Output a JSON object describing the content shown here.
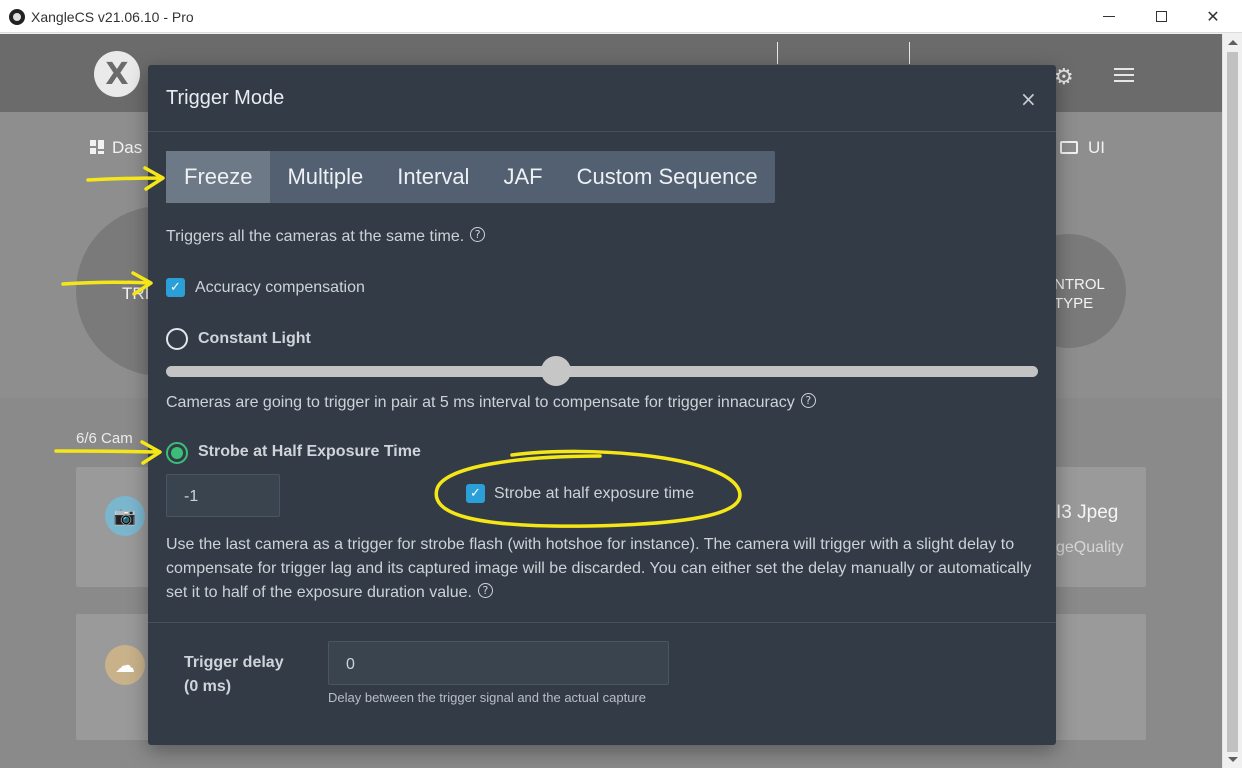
{
  "window": {
    "title": "XangleCS v21.06.10 - Pro",
    "minimize_glyph": "",
    "maximize_glyph": "",
    "close_glyph": "✕"
  },
  "background_app": {
    "logo_glyph": "X",
    "dashboard_label": "Das",
    "ui_label": "UI",
    "left_circle_text": "TRI",
    "right_circle_line1": "NTROL",
    "right_circle_line2": "TYPE",
    "camera_count": "6/6 Cam",
    "jpeg_label": "I3 Jpeg",
    "jpeg_sub": "geQuality",
    "icons": [
      "gear-icon",
      "menu-icon",
      "dashboard-icon",
      "monitor-icon",
      "camera-icon",
      "cloud-icon"
    ]
  },
  "modal": {
    "title": "Trigger Mode",
    "close_glyph": "×",
    "tabs": [
      {
        "label": "Freeze",
        "active": true
      },
      {
        "label": "Multiple",
        "active": false
      },
      {
        "label": "Interval",
        "active": false
      },
      {
        "label": "JAF",
        "active": false
      },
      {
        "label": "Custom Sequence",
        "active": false
      }
    ],
    "description": "Triggers all the cameras at the same time.",
    "help_glyph": "?",
    "accuracy": {
      "label": "Accuracy compensation",
      "checked": true
    },
    "constant_light": {
      "label": "Constant Light",
      "selected": false
    },
    "slider": {
      "value_fraction": 0.44
    },
    "slider_description": "Cameras are going to trigger in pair at 5 ms interval to compensate for trigger innacuracy",
    "strobe": {
      "label": "Strobe at Half Exposure Time",
      "selected": true,
      "input_value": "-1",
      "checkbox_label": "Strobe at half exposure time",
      "checkbox_checked": true,
      "description": "Use the last camera as a trigger for strobe flash (with hotshoe for instance). The camera will trigger with a slight delay to compensate for trigger lag and its captured image will be discarded. You can either set the delay manually or automatically set it to half of the exposure duration value."
    },
    "trigger_delay": {
      "label_line1": "Trigger delay",
      "label_line2": "(0 ms)",
      "value": "0",
      "help": "Delay between the trigger signal and the actual capture"
    },
    "checkmark_glyph": "✓"
  },
  "colors": {
    "modal_bg": "#333c46",
    "accent_blue": "#2b9fd8",
    "radio_green": "#3bbf78",
    "annotation_yellow": "#f5e617"
  }
}
